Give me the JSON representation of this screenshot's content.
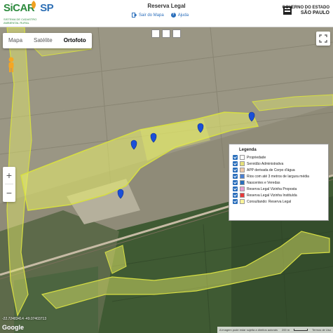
{
  "header": {
    "logo_title_a": "SiCAR",
    "logo_title_b": "SP",
    "logo_subtitle": "SISTEMA DE CADASTRO AMBIENTAL RURAL",
    "page_title": "Reserva Legal",
    "links": [
      {
        "label": "Sair do Mapa",
        "icon": "exit-icon"
      },
      {
        "label": "Ajuda",
        "icon": "help-icon"
      }
    ],
    "gov_line1": "GOVERNO DO ESTADO",
    "gov_line2": "SÃO PAULO"
  },
  "map": {
    "map_types": [
      {
        "label": "Mapa",
        "active": false
      },
      {
        "label": "Satélite",
        "active": false
      },
      {
        "label": "Ortofoto",
        "active": true
      }
    ],
    "zoom_in": "+",
    "zoom_out": "−",
    "coordinates": "-22.72483414 -49.07403713",
    "google_label": "Google",
    "attribution": "A imagem pode estar sujeita a direitos autorais",
    "scale_label": "200 m",
    "terms_label": "Termos de Uso"
  },
  "legend": {
    "title": "Legenda",
    "items": [
      {
        "label": "Propriedade",
        "checked": true,
        "color": "#ffffff"
      },
      {
        "label": "Servidão Administrativa",
        "checked": true,
        "color": "#e6e07a"
      },
      {
        "label": "APP derivada de Corpo d'água",
        "checked": true,
        "color": "#f0c9a8"
      },
      {
        "label": "Rios com até 3 metros de largura média",
        "checked": true,
        "color": "#4a7fd0"
      },
      {
        "label": "Nascentes e Veredas",
        "checked": true,
        "color": "#2a6ebb"
      },
      {
        "label": "Reserva Legal Vizinha Proposta",
        "checked": true,
        "color": "#e8a0d0"
      },
      {
        "label": "Reserva Legal Vizinha Instituída",
        "checked": true,
        "color": "#e83a3a"
      },
      {
        "label": "Consultando: Reserva Legal",
        "checked": true,
        "color": "#fff59a"
      }
    ]
  },
  "colors": {
    "accent": "#2a6ebb",
    "brand_green": "#2d8a3e",
    "overlay_yellow": "#e7ee6a"
  }
}
